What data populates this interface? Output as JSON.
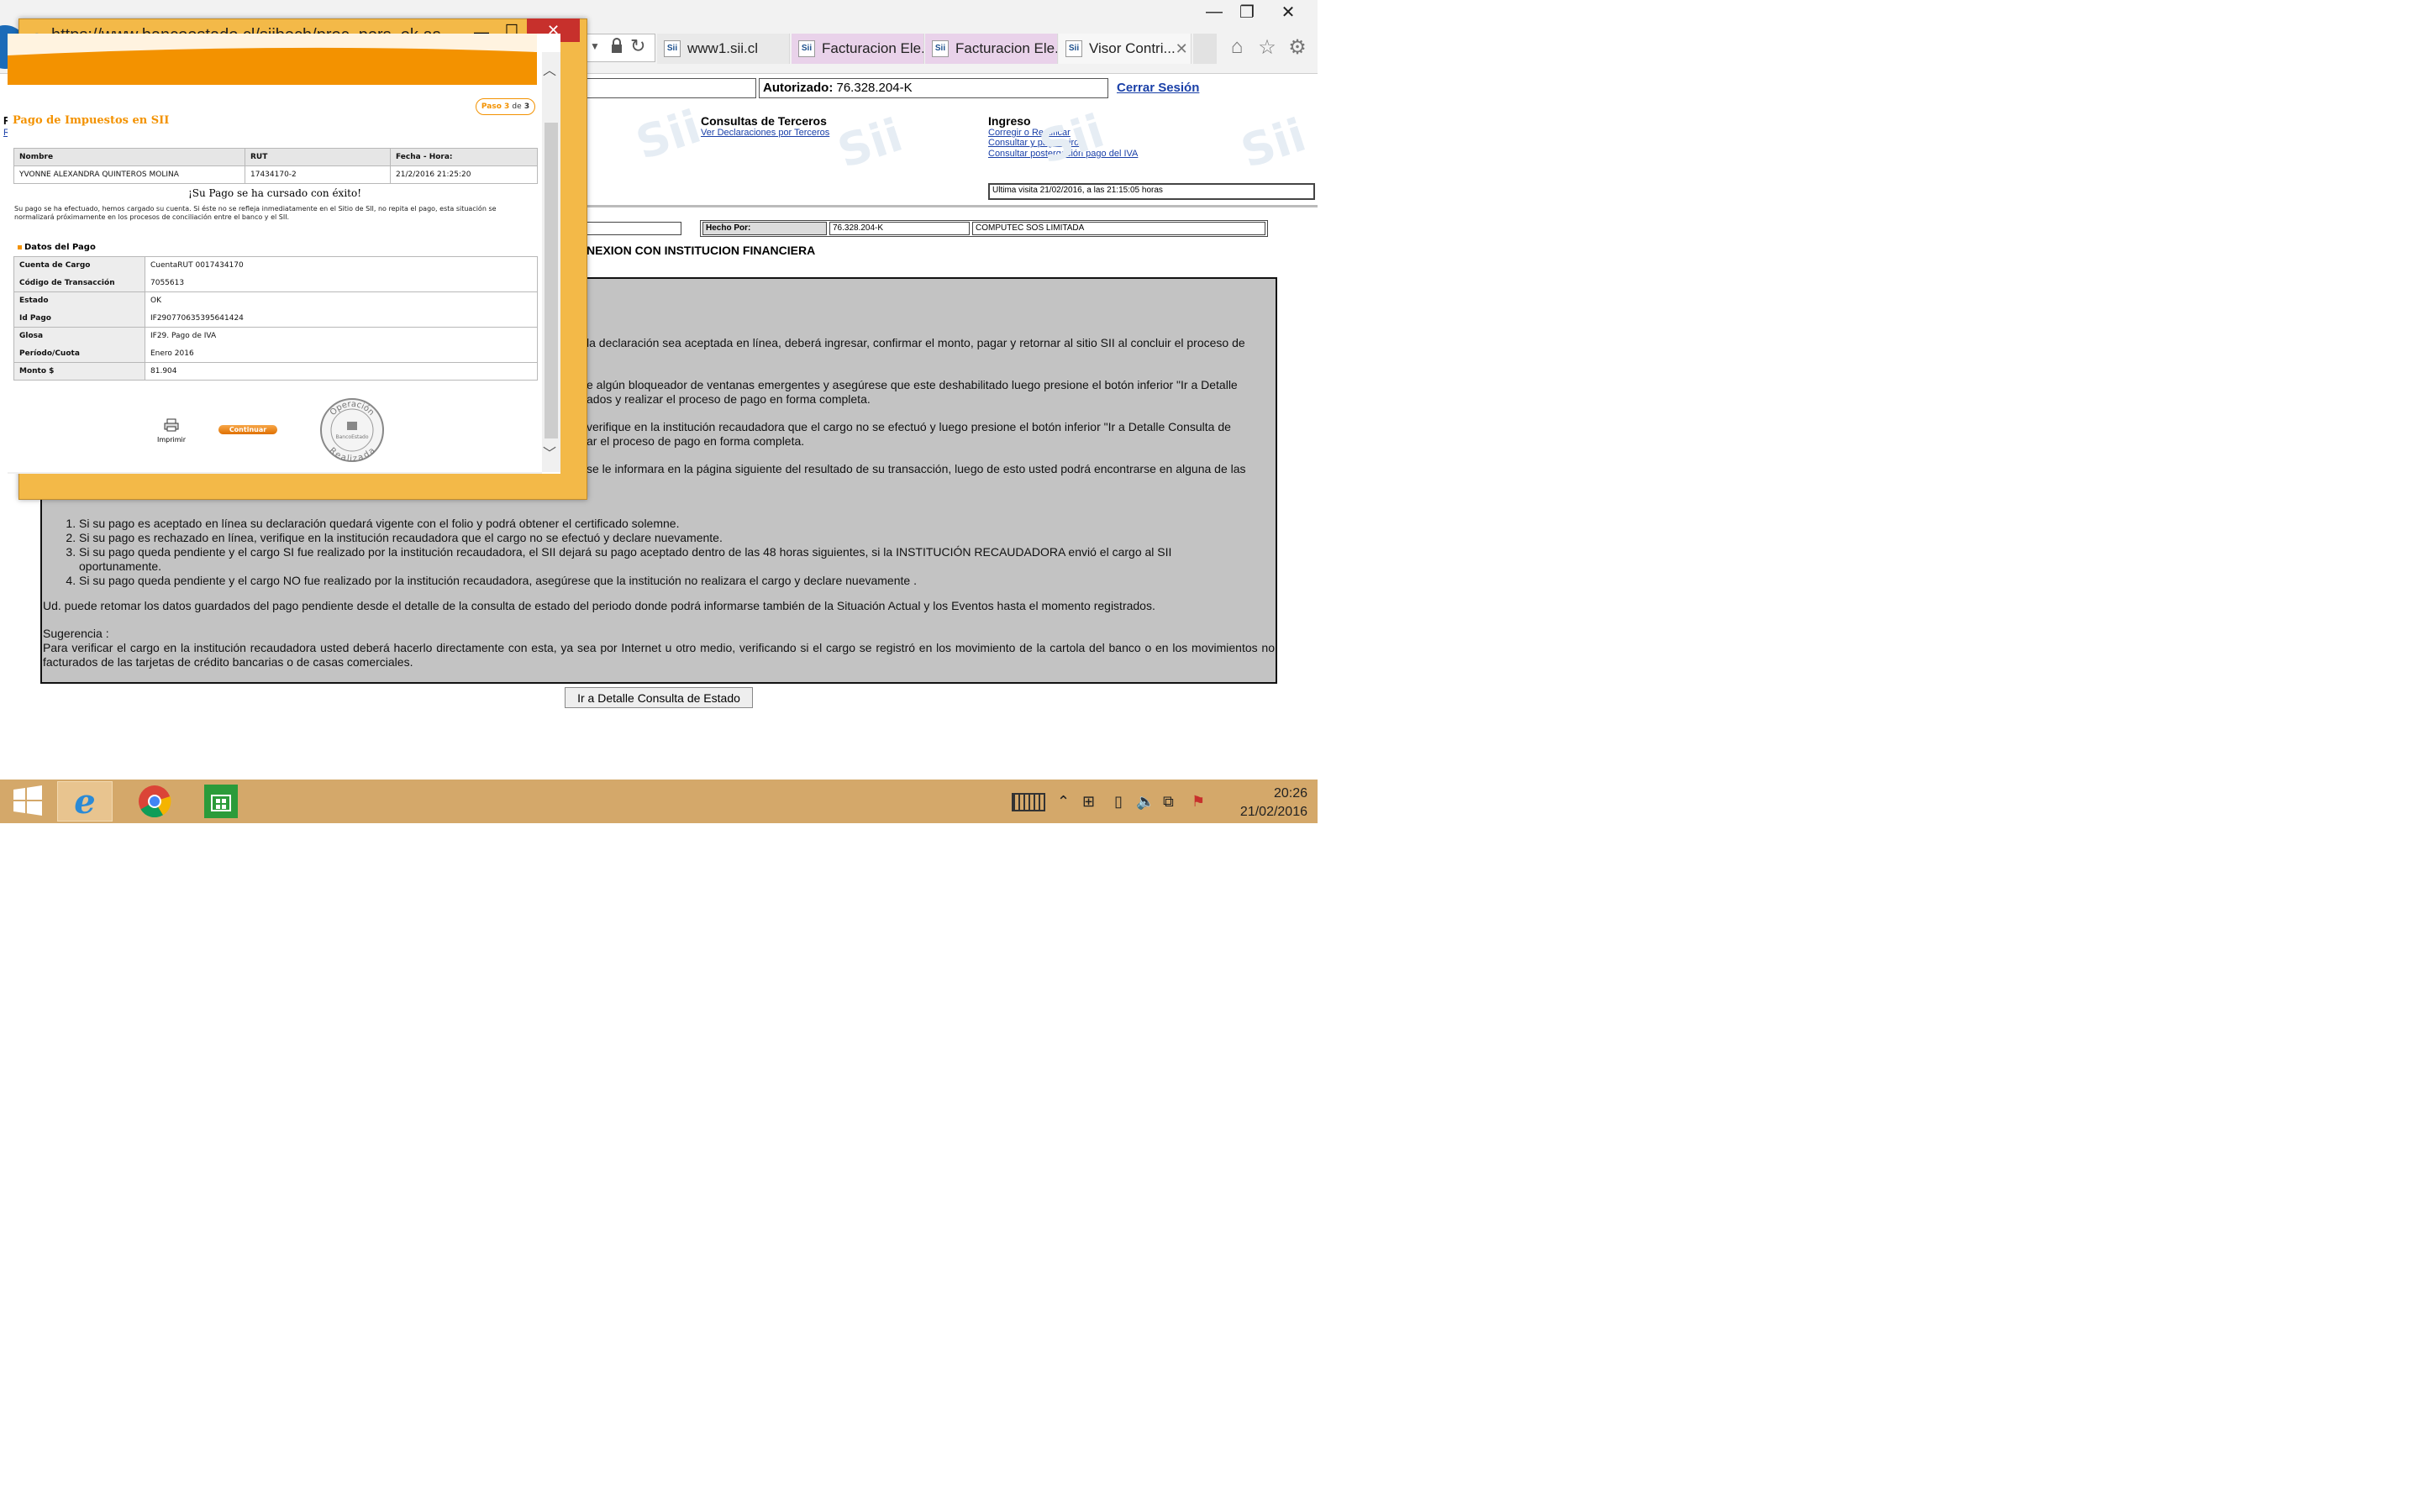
{
  "browser": {
    "address": "https://www.bancoestado.cl/siibech/proc_pers_ok.as...",
    "tabs": [
      {
        "label": "www1.sii.cl"
      },
      {
        "label": "Facturacion Ele..."
      },
      {
        "label": "Facturacion Ele..."
      },
      {
        "label": "Visor Contri..."
      }
    ],
    "window_controls": {
      "minimize": "—",
      "maximize": "❐",
      "close": "✕"
    }
  },
  "sii": {
    "autorizado_label": "Autorizado:",
    "autorizado_value": "76.328.204-K",
    "cerrar_sesion": "Cerrar Sesión",
    "left_fragments": [
      "Re:",
      "Res"
    ],
    "consultas_title": "Consultas de Terceros",
    "consultas_link": "Ver Declaraciones por Terceros",
    "ingreso_title": "Ingreso",
    "ingreso_links": [
      "Corregir o Rectificar",
      "Consultar y pagar giros",
      "Consultar postergación pago del IVA"
    ],
    "ultima_visita": "Ultima visita 21/02/2016, a las 21:15:05 horas",
    "hecho_por_label": "Hecho Por:",
    "hecho_por_rut": "76.328.204-K",
    "hecho_por_name": "COMPUTEC SOS LIMITADA",
    "section_title": "NEXION CON INSTITUCION FINANCIERA",
    "partial_paragraphs": [
      "la declaración sea aceptada en línea, deberá ingresar, confirmar el monto, pagar y retornar al sitio SII al concluir el proceso de",
      "e algún bloqueador de ventanas emergentes y asegúrese que este deshabilitado luego presione el botón inferior \"Ir a Detalle",
      "ados y realizar el proceso de pago en forma completa.",
      "verifique en la institución recaudadora que el cargo no se efectuó y luego presione el botón inferior \"Ir a Detalle Consulta de",
      "ar el proceso de pago en forma completa.",
      "se le informara en la página siguiente del resultado de su transacción, luego de esto usted podrá encontrarse en alguna de las"
    ],
    "list_items": [
      "Si su pago es aceptado en línea su declaración quedará vigente con el folio y podrá obtener el certificado solemne.",
      "Si su pago es rechazado en línea, verifique en la institución recaudadora que el cargo no se efectuó y declare nuevamente.",
      "Si su pago queda pendiente y el cargo SI fue realizado por la institución recaudadora, el SII dejará su pago aceptado dentro de las 48 horas siguientes, si la INSTITUCIÓN RECAUDADORA envió el cargo al SII oportunamente.",
      "Si su pago queda pendiente y el cargo NO fue realizado por la institución recaudadora, asegúrese que la institución no realizara el cargo y declare nuevamente ."
    ],
    "retomar_text": "Ud. puede retomar los datos guardados del pago pendiente desde el detalle de la consulta de estado del periodo donde podrá informarse también de la Situación Actual y los Eventos hasta el momento registrados.",
    "sugerencia_title": "Sugerencia :",
    "sugerencia_text": "Para verificar el cargo en la institución recaudadora usted deberá hacerlo directamente con esta, ya sea por Internet u otro medio, verificando si el cargo se registró en los movimiento de la cartola del banco o en los movimientos no facturados de las tarjetas de crédito bancarias o de casas comerciales.",
    "detalle_button": "Ir a Detalle Consulta de Estado"
  },
  "popup": {
    "step_label": "Paso",
    "step_current": "3",
    "step_of": "de",
    "step_total": "3",
    "title": "Pago de Impuestos en SII",
    "table_headers": [
      "Nombre",
      "RUT",
      "Fecha - Hora:"
    ],
    "table_values": [
      "YVONNE ALEXANDRA QUINTEROS MOLINA",
      "17434170-2",
      "21/2/2016 21:25:20"
    ],
    "success": "¡Su Pago se ha cursado con éxito!",
    "info": "Su pago se ha efectuado, hemos cargado su cuenta. Si éste no se refleja inmediatamente en el Sitio de SII, no repita el pago, esta situación se normalizará próximamente en los procesos de conciliación entre el banco y el SII.",
    "datos_title": "Datos del Pago",
    "datos": [
      {
        "label": "Cuenta de Cargo",
        "value": "CuentaRUT  0017434170"
      },
      {
        "label": "Código de Transacción",
        "value": "7055613"
      },
      {
        "label": "Estado",
        "value": "OK"
      },
      {
        "label": "Id Pago",
        "value": "IF290770635395641424"
      },
      {
        "label": "Glosa",
        "value": "IF29. Pago de IVA"
      },
      {
        "label": "Período/Cuota",
        "value": "Enero 2016"
      },
      {
        "label": "Monto $",
        "value": "81.904"
      }
    ],
    "imprimir": "Imprimir",
    "continuar": "Continuar",
    "stamp_top": "Operación",
    "stamp_center": "BancoEstado",
    "stamp_bottom": "Realizada"
  },
  "taskbar": {
    "time": "20:26",
    "date": "21/02/2016"
  },
  "colors": {
    "accent_orange": "#f39200",
    "link_blue": "#1a40a8",
    "popup_frame": "#f3b948",
    "tab_pink": "#e9d2ea",
    "taskbar": "#d4a86a",
    "close_red": "#c7302c"
  }
}
